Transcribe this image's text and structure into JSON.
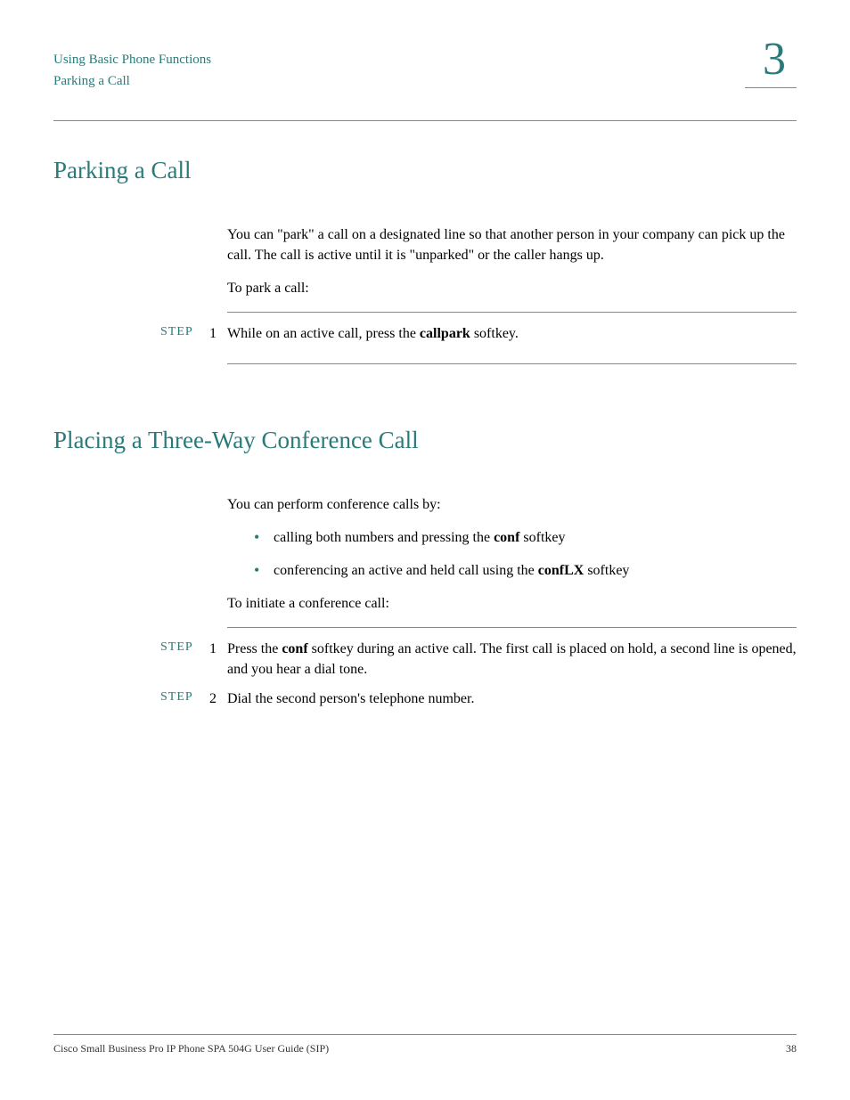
{
  "header": {
    "line1": "Using Basic Phone Functions",
    "line2": "Parking a Call",
    "chapter": "3"
  },
  "section1": {
    "heading": "Parking a Call",
    "intro": "You can \"park\" a call on a designated line so that another person in your company can pick up the call. The call is active until it is \"unparked\" or the caller hangs up.",
    "lead": "To park a call:",
    "step1": {
      "label": "STEP",
      "num": "1",
      "text_before": "While on an active call, press the ",
      "bold": "callpark",
      "text_after": " softkey."
    }
  },
  "section2": {
    "heading": "Placing a Three-Way Conference Call",
    "intro": "You can perform conference calls by:",
    "bullet1": {
      "before": "calling both numbers and pressing the ",
      "bold": "conf",
      "after": " softkey"
    },
    "bullet2": {
      "before": "conferencing an active and held call using the ",
      "bold": "confLX",
      "after": " softkey"
    },
    "lead": "To initiate a conference call:",
    "step1": {
      "label": "STEP",
      "num": "1",
      "before": "Press the ",
      "bold": "conf",
      "after": " softkey during an active call. The first call is placed on hold, a second line is opened, and you hear a dial tone."
    },
    "step2": {
      "label": "STEP",
      "num": "2",
      "text": "Dial the second person's telephone number."
    }
  },
  "footer": {
    "title": "Cisco Small Business Pro IP Phone SPA 504G User Guide (SIP)",
    "page": "38"
  }
}
